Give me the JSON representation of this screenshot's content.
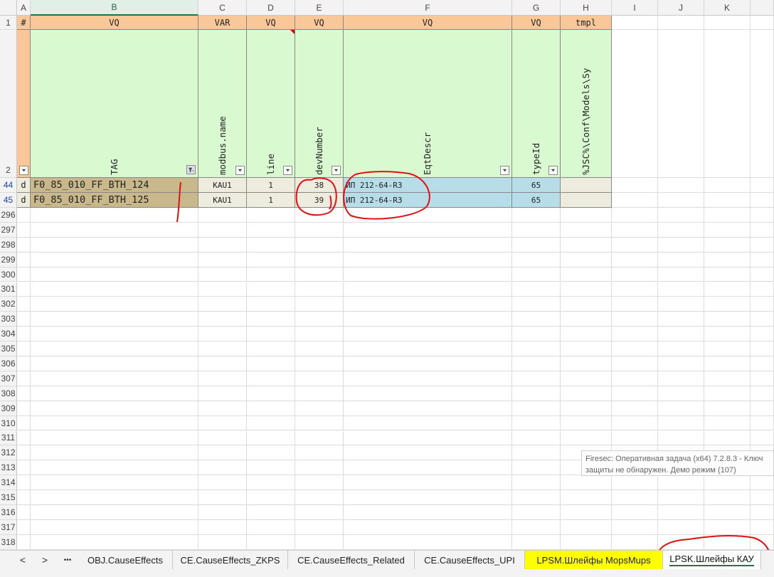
{
  "columns": [
    "A",
    "B",
    "C",
    "D",
    "E",
    "F",
    "G",
    "H",
    "I",
    "J",
    "K"
  ],
  "row_numbers": {
    "header": [
      "1",
      "2"
    ],
    "data": [
      "44",
      "45"
    ],
    "empty": [
      "296",
      "297",
      "298",
      "299",
      "300",
      "301",
      "302",
      "303",
      "304",
      "305",
      "306",
      "307",
      "308",
      "309",
      "310",
      "311",
      "312",
      "313",
      "314",
      "315",
      "316",
      "317",
      "318"
    ]
  },
  "row1": {
    "A": "#",
    "B": "VQ",
    "C": "VAR",
    "D": "VQ",
    "E": "VQ",
    "F": "VQ",
    "G": "VQ",
    "H": "tmpl"
  },
  "row2": {
    "B": "TAG",
    "C": "modbus.name",
    "D": "line",
    "E": "devNumber",
    "F": "EqtDescr",
    "G": "typeId",
    "H": "%JSC%\\Conf\\Models\\Sy"
  },
  "data_rows": [
    {
      "A": "d",
      "B": "F0_85_010_FF_BTH_124",
      "C": "KAU1",
      "D": "1",
      "E": "38",
      "F": "ИП 212-64-R3",
      "G": "65",
      "H": ""
    },
    {
      "A": "d",
      "B": "F0_85_010_FF_BTH_125",
      "C": "KAU1",
      "D": "1",
      "E": "39",
      "F": "ИП 212-64-R3",
      "G": "65",
      "H": ""
    }
  ],
  "tabs": [
    "OBJ.CauseEffects",
    "CE.CauseEffects_ZKPS",
    "CE.CauseEffects_Related",
    "CE.CauseEffects_UPI",
    "LPSM.Шлейфы MopsMups",
    "LPSK.Шлейфы КАУ"
  ],
  "nav": {
    "prev": "<",
    "next": ">",
    "more": "•••"
  },
  "tooltip": {
    "line1": "Firesec: Оперативная задача  (x64) 7.2.8.3 - Ключ",
    "line2": "защиты не обнаружен. Демо режим (107)"
  },
  "colors": {
    "header_orange": "#fac898",
    "header_green": "#d9f9d0",
    "tag_fill": "#c8b88c",
    "descr_fill": "#b7dde8",
    "active_tab_yellow": "#ffff00",
    "annotation_red": "#e01010"
  }
}
